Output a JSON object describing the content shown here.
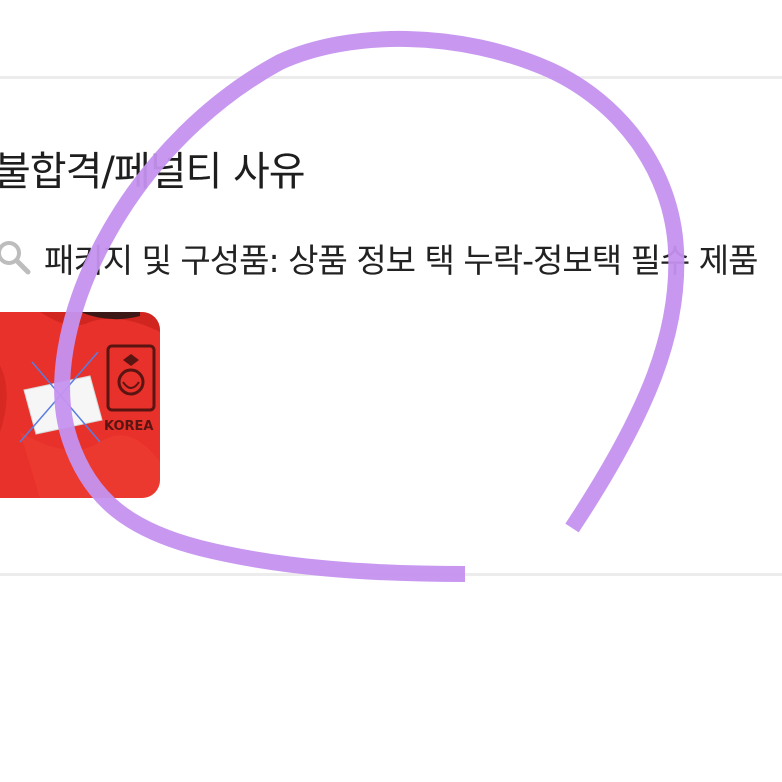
{
  "section": {
    "title": "불합격/페널티 사유"
  },
  "reason": {
    "icon": "search-icon",
    "text": "패키지 및 구성품: 상품 정보 택 누락-정보택 필수 제품"
  },
  "photo": {
    "jersey_text": "KOREA",
    "colors": {
      "jersey": "#e8312a",
      "crest": "#5a1512",
      "annotation_stroke": "#c592f0"
    }
  }
}
